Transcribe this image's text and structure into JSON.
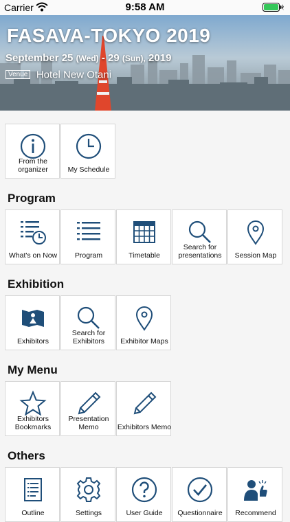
{
  "status": {
    "carrier": "Carrier",
    "time": "9:58 AM"
  },
  "banner": {
    "title": "FASAVA-TOKYO 2019",
    "date_start": "September 25",
    "day_start": "(Wed)",
    "date_sep": "-",
    "date_end": "29",
    "day_end": "(Sun),",
    "year": "2019",
    "venue_tag": "Venue",
    "venue_name": "Hotel New Otani"
  },
  "top_tiles": [
    {
      "label": "From the organizer",
      "icon": "info-icon"
    },
    {
      "label": "My Schedule",
      "icon": "clock-icon"
    }
  ],
  "sections": {
    "program": {
      "title": "Program",
      "tiles": [
        {
          "label": "What's on Now",
          "icon": "list-clock-icon"
        },
        {
          "label": "Program",
          "icon": "list-icon"
        },
        {
          "label": "Timetable",
          "icon": "calendar-grid-icon"
        },
        {
          "label": "Search for presentations",
          "icon": "search-icon"
        },
        {
          "label": "Session Map",
          "icon": "map-pin-icon"
        }
      ]
    },
    "exhibition": {
      "title": "Exhibition",
      "tiles": [
        {
          "label": "Exhibitors",
          "icon": "exhibitor-booth-icon"
        },
        {
          "label": "Search for Exhibitors",
          "icon": "search-icon"
        },
        {
          "label": "Exhibitor Maps",
          "icon": "map-pin-icon"
        }
      ]
    },
    "my_menu": {
      "title": "My Menu",
      "tiles": [
        {
          "label": "Exhibitors Bookmarks",
          "icon": "star-icon"
        },
        {
          "label": "Presentation Memo",
          "icon": "pencil-icon"
        },
        {
          "label": "Exhibitors Memo",
          "icon": "pencil-icon"
        }
      ]
    },
    "others": {
      "title": "Others",
      "tiles": [
        {
          "label": "Outline",
          "icon": "document-icon"
        },
        {
          "label": "Settings",
          "icon": "gear-icon"
        },
        {
          "label": "User Guide",
          "icon": "question-icon"
        },
        {
          "label": "Questionnaire",
          "icon": "checkmark-icon"
        },
        {
          "label": "Recommend",
          "icon": "recommend-icon"
        }
      ]
    }
  },
  "colors": {
    "icon": "#1f4e79",
    "background": "#f5f5f5",
    "battery": "#34c759"
  }
}
